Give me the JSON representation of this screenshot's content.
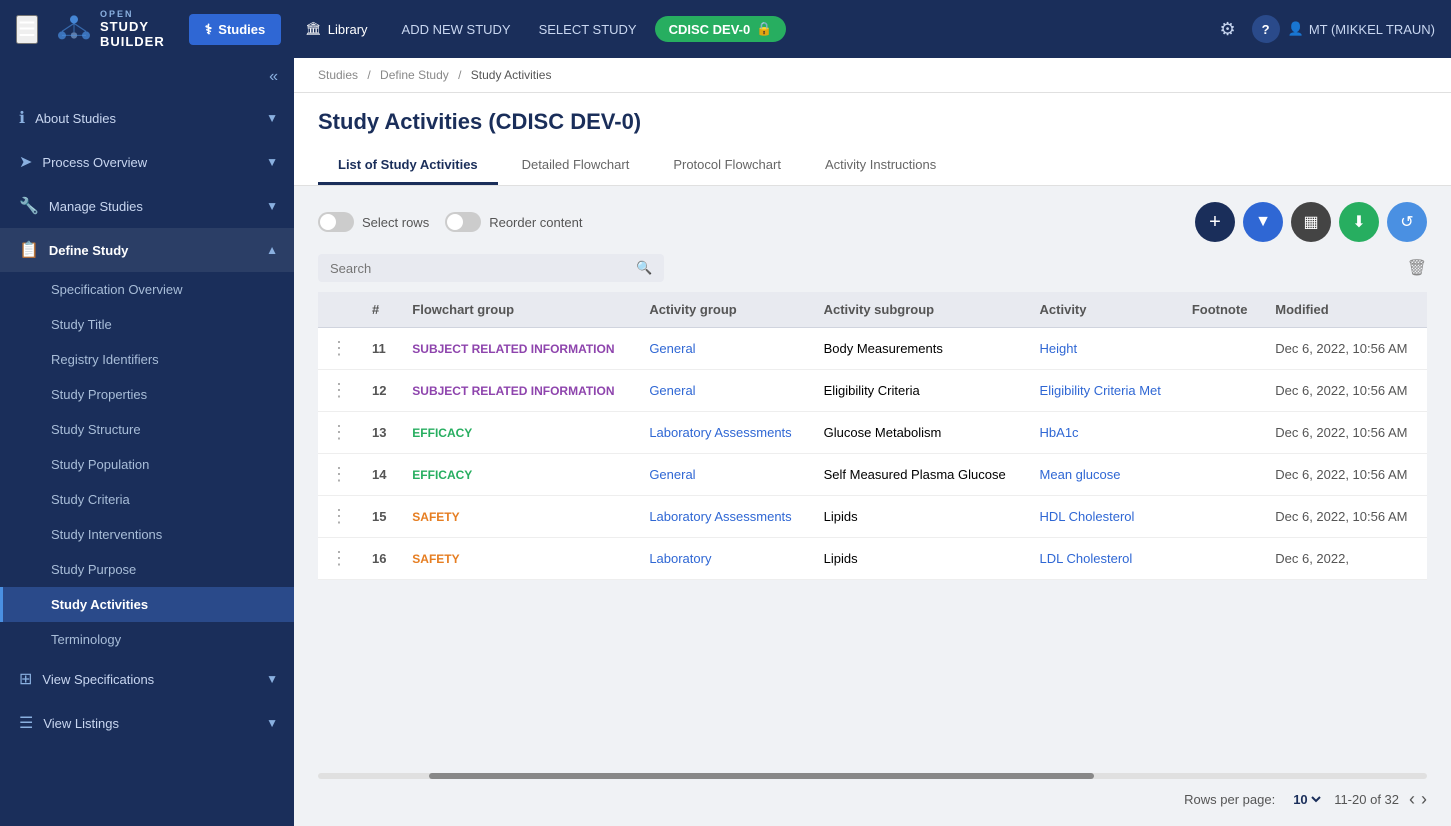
{
  "topNav": {
    "hamburger": "☰",
    "logoLine1": "OPEN",
    "logoLine2": "STUDY",
    "logoLine3": "BUILDER",
    "studiesBtn": "Studies",
    "libraryBtn": "Library",
    "addNewStudy": "ADD NEW STUDY",
    "selectStudy": "SELECT STUDY",
    "studyBadge": "CDISC DEV-0",
    "lockIcon": "🔒",
    "settingsIcon": "⚙",
    "helpIcon": "?",
    "userIcon": "👤",
    "userName": "MT (MIKKEL TRAUN)"
  },
  "sidebar": {
    "collapseIcon": "«",
    "items": [
      {
        "id": "about-studies",
        "icon": "ℹ",
        "label": "About Studies",
        "hasChevron": true,
        "active": false
      },
      {
        "id": "process-overview",
        "icon": "→",
        "label": "Process Overview",
        "hasChevron": true,
        "active": false
      },
      {
        "id": "manage-studies",
        "icon": "🔧",
        "label": "Manage Studies",
        "hasChevron": true,
        "active": false
      },
      {
        "id": "define-study",
        "icon": "📋",
        "label": "Define Study",
        "hasChevron": true,
        "active": true
      }
    ],
    "subItems": [
      {
        "id": "specification-overview",
        "label": "Specification Overview",
        "active": false
      },
      {
        "id": "study-title",
        "label": "Study Title",
        "active": false
      },
      {
        "id": "registry-identifiers",
        "label": "Registry Identifiers",
        "active": false
      },
      {
        "id": "study-properties",
        "label": "Study Properties",
        "active": false
      },
      {
        "id": "study-structure",
        "label": "Study Structure",
        "active": false
      },
      {
        "id": "study-population",
        "label": "Study Population",
        "active": false
      },
      {
        "id": "study-criteria",
        "label": "Study Criteria",
        "active": false
      },
      {
        "id": "study-interventions",
        "label": "Study Interventions",
        "active": false
      },
      {
        "id": "study-purpose",
        "label": "Study Purpose",
        "active": false
      },
      {
        "id": "study-activities",
        "label": "Study Activities",
        "active": true
      },
      {
        "id": "terminology",
        "label": "Terminology",
        "active": false
      }
    ],
    "bottomItems": [
      {
        "id": "view-specifications",
        "icon": "⊞",
        "label": "View Specifications",
        "hasChevron": true
      },
      {
        "id": "view-listings",
        "icon": "☰",
        "label": "View Listings",
        "hasChevron": true
      }
    ]
  },
  "breadcrumb": {
    "parts": [
      "Studies",
      "Define Study",
      "Study Activities"
    ],
    "separators": [
      "/",
      "/"
    ]
  },
  "page": {
    "title": "Study Activities (CDISC DEV-0)",
    "tabs": [
      {
        "id": "list",
        "label": "List of Study Activities",
        "active": true
      },
      {
        "id": "flowchart",
        "label": "Detailed Flowchart",
        "active": false
      },
      {
        "id": "protocol",
        "label": "Protocol Flowchart",
        "active": false
      },
      {
        "id": "instructions",
        "label": "Activity Instructions",
        "active": false
      }
    ]
  },
  "toolbar": {
    "selectRowsLabel": "Select rows",
    "reorderLabel": "Reorder content",
    "addIcon": "+",
    "filterIcon": "▼",
    "columnsIcon": "⊞",
    "downloadIcon": "↓",
    "historyIcon": "↺"
  },
  "search": {
    "placeholder": "Search",
    "deleteIcon": "🗑"
  },
  "table": {
    "columns": [
      "",
      "#",
      "Flowchart group",
      "Activity group",
      "Activity subgroup",
      "Activity",
      "Footnote",
      "Modified"
    ],
    "rows": [
      {
        "dots": "⋮",
        "num": "11",
        "flowchartGroup": "SUBJECT RELATED INFORMATION",
        "activityGroup": "General",
        "activitySubgroup": "Body Measurements",
        "activity": "Height",
        "footnote": "",
        "modified": "Dec 6, 2022, 10:56 AM"
      },
      {
        "dots": "⋮",
        "num": "12",
        "flowchartGroup": "SUBJECT RELATED INFORMATION",
        "activityGroup": "General",
        "activitySubgroup": "Eligibility Criteria",
        "activity": "Eligibility Criteria Met",
        "footnote": "",
        "modified": "Dec 6, 2022, 10:56 AM"
      },
      {
        "dots": "⋮",
        "num": "13",
        "flowchartGroup": "EFFICACY",
        "activityGroup": "Laboratory Assessments",
        "activitySubgroup": "Glucose Metabolism",
        "activity": "HbA1c",
        "footnote": "",
        "modified": "Dec 6, 2022, 10:56 AM"
      },
      {
        "dots": "⋮",
        "num": "14",
        "flowchartGroup": "EFFICACY",
        "activityGroup": "General",
        "activitySubgroup": "Self Measured Plasma Glucose",
        "activity": "Mean glucose",
        "footnote": "",
        "modified": "Dec 6, 2022, 10:56 AM"
      },
      {
        "dots": "⋮",
        "num": "15",
        "flowchartGroup": "SAFETY",
        "activityGroup": "Laboratory Assessments",
        "activitySubgroup": "Lipids",
        "activity": "HDL Cholesterol",
        "footnote": "",
        "modified": "Dec 6, 2022, 10:56 AM"
      },
      {
        "dots": "⋮",
        "num": "16",
        "flowchartGroup": "SAFETY",
        "activityGroup": "Laboratory",
        "activitySubgroup": "Lipids",
        "activity": "LDL Cholesterol",
        "footnote": "",
        "modified": "Dec 6, 2022,"
      }
    ]
  },
  "pagination": {
    "rowsPerPageLabel": "Rows per page:",
    "rowsPerPage": "10",
    "range": "11-20 of 32",
    "prevDisabled": false,
    "nextDisabled": false
  }
}
